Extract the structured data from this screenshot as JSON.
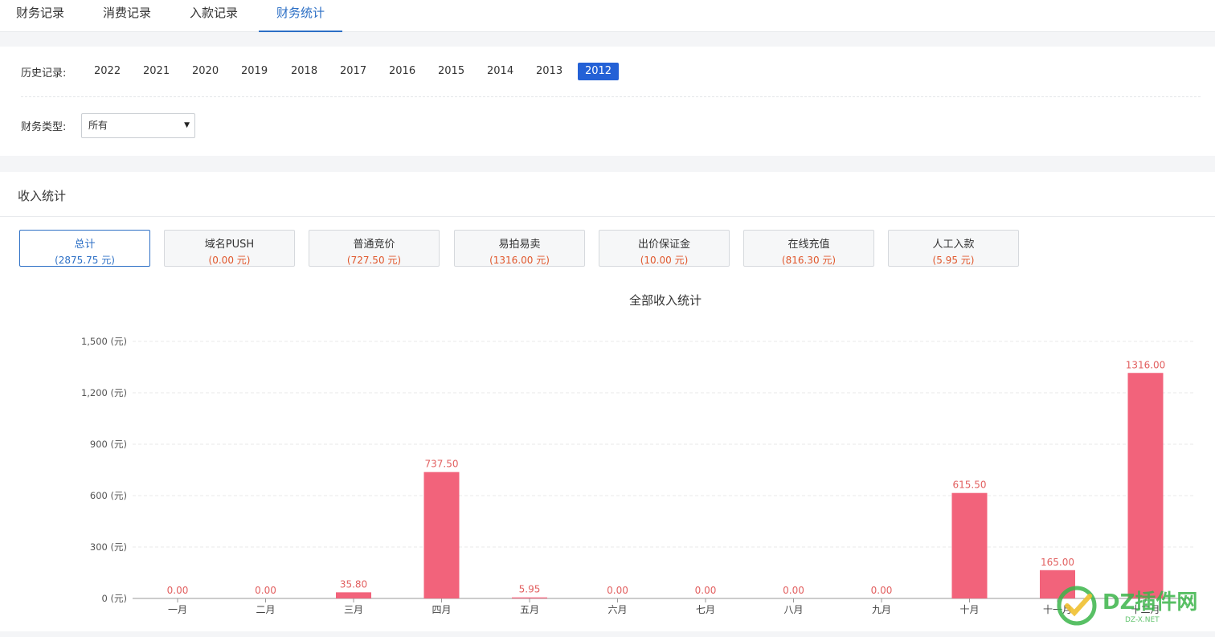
{
  "tabs": [
    {
      "label": "财务记录",
      "active": false
    },
    {
      "label": "消费记录",
      "active": false
    },
    {
      "label": "入款记录",
      "active": false
    },
    {
      "label": "财务统计",
      "active": true
    }
  ],
  "filters": {
    "history_label": "历史记录:",
    "years": [
      "2022",
      "2021",
      "2020",
      "2019",
      "2018",
      "2017",
      "2016",
      "2015",
      "2014",
      "2013",
      "2012"
    ],
    "selected_year": "2012",
    "type_label": "财务类型:",
    "type_value": "所有"
  },
  "income": {
    "title": "收入统计",
    "categories": [
      {
        "name": "总计",
        "value": "(2875.75 元)",
        "active": true
      },
      {
        "name": "域名PUSH",
        "value": "(0.00 元)",
        "active": false
      },
      {
        "name": "普通竞价",
        "value": "(727.50 元)",
        "active": false
      },
      {
        "name": "易拍易卖",
        "value": "(1316.00 元)",
        "active": false
      },
      {
        "name": "出价保证金",
        "value": "(10.00 元)",
        "active": false
      },
      {
        "name": "在线充值",
        "value": "(816.30 元)",
        "active": false
      },
      {
        "name": "人工入款",
        "value": "(5.95 元)",
        "active": false
      }
    ]
  },
  "chart_data": {
    "type": "bar",
    "title": "全部收入统计",
    "categories": [
      "一月",
      "二月",
      "三月",
      "四月",
      "五月",
      "六月",
      "七月",
      "八月",
      "九月",
      "十月",
      "十一月",
      "十二月"
    ],
    "values": [
      0,
      0,
      35.8,
      737.5,
      5.95,
      0,
      0,
      0,
      0,
      615.5,
      165,
      1316
    ],
    "data_labels": [
      "0.00",
      "0.00",
      "35.80",
      "737.50",
      "5.95",
      "0.00",
      "0.00",
      "0.00",
      "0.00",
      "615.50",
      "165.00",
      "1316.00"
    ],
    "y_ticks": [
      0,
      300,
      600,
      900,
      1200,
      1500
    ],
    "y_tick_labels": [
      "0 (元)",
      "300 (元)",
      "600 (元)",
      "900 (元)",
      "1,200 (元)",
      "1,500 (元)"
    ],
    "ylim": [
      0,
      1500
    ],
    "grid": true,
    "bar_color": "#f2637b",
    "label_color": "#e26060"
  },
  "watermark": {
    "text": "DZ插件网",
    "subtext": "DZ-X.NET",
    "color": "#3bb54a"
  }
}
